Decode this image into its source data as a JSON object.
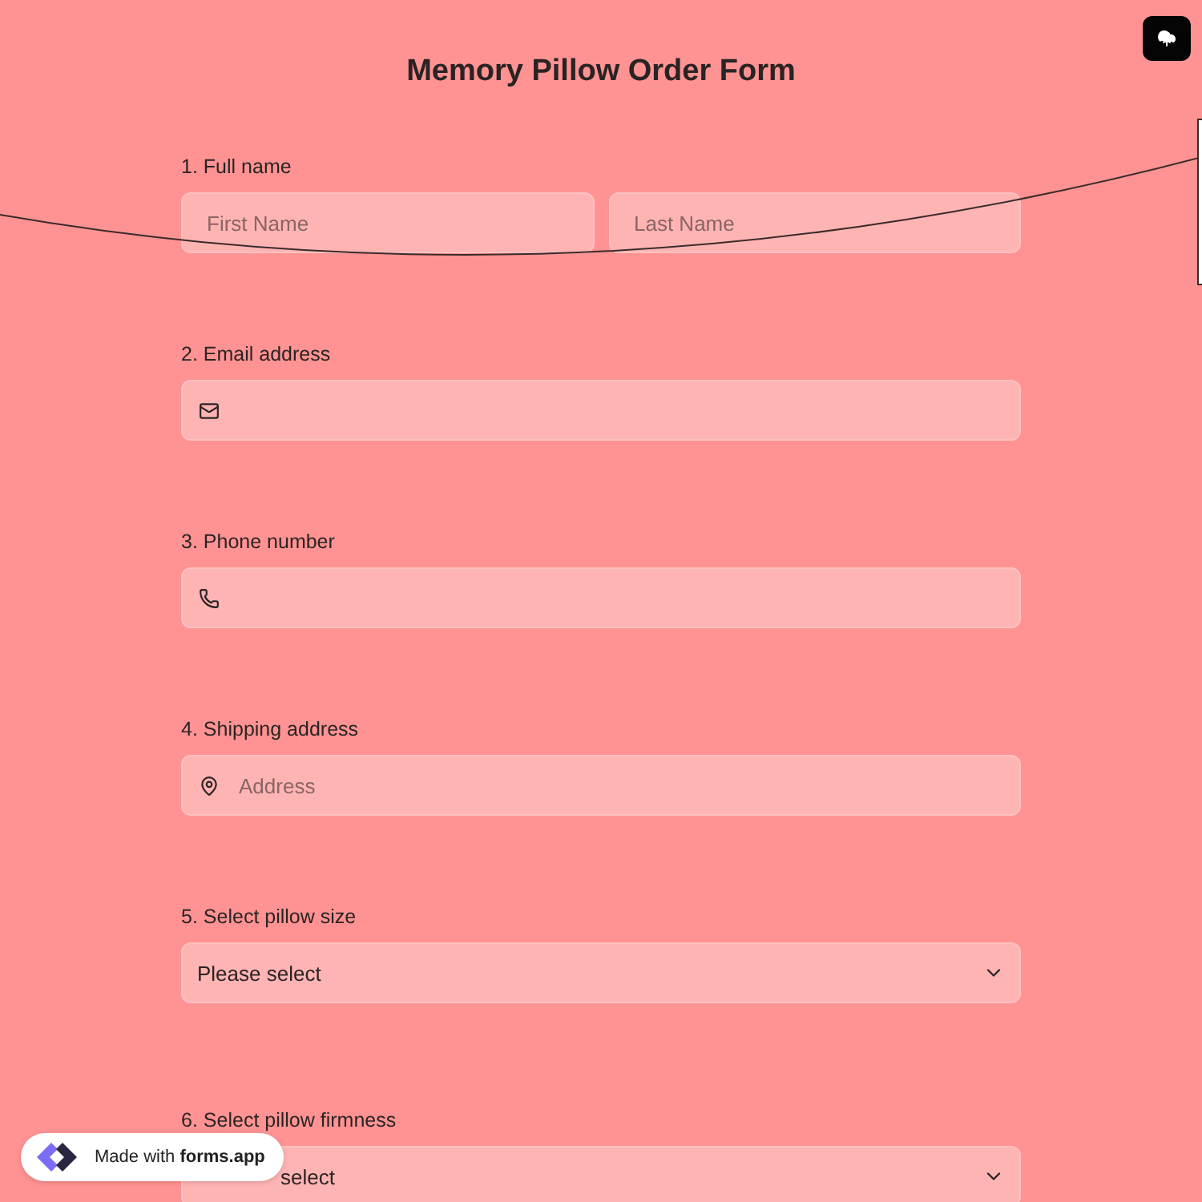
{
  "title": "Memory Pillow Order Form",
  "questions": [
    {
      "number": "1.",
      "label": "Full name",
      "kind": "name",
      "fields": [
        {
          "placeholder": "First Name"
        },
        {
          "placeholder": "Last Name"
        }
      ]
    },
    {
      "number": "2.",
      "label": "Email address",
      "kind": "email"
    },
    {
      "number": "3.",
      "label": "Phone number",
      "kind": "phone"
    },
    {
      "number": "4.",
      "label": "Shipping address",
      "kind": "address",
      "placeholder": "Address"
    },
    {
      "number": "5.",
      "label": "Select pillow size",
      "kind": "select",
      "value": "Please select",
      "partly_covered": false
    },
    {
      "number": "6.",
      "label": "Select pillow firmness",
      "kind": "select",
      "value": "select",
      "partly_covered": true
    }
  ],
  "badge": {
    "prefix": "Made with",
    "brand": "forms.app"
  }
}
